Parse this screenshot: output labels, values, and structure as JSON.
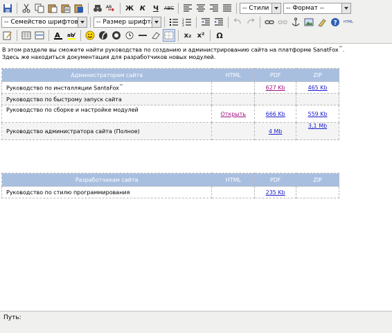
{
  "toolbar": {
    "styles_select": "-- Стили --",
    "format_select": "-- Формат --",
    "font_family_select": "-- Семейство шрифтов --",
    "font_size_select": "-- Размер шрифта --",
    "bold": "Ж",
    "italic": "К",
    "underline": "Ч",
    "strike": "ABC",
    "spell": "ABC",
    "subscript": "x₂",
    "superscript": "x²",
    "omega": "Ω",
    "html": "HTML"
  },
  "intro": {
    "line1_prefix": "В этом разделе вы сможете найти руководства по созданию и администрированию сайта на платформе SanatFox",
    "line1_tm": "™",
    "line1_suffix": ".",
    "line2": "Здесь же находиться документация для разработчиков новых модулей."
  },
  "admin_table": {
    "headers": [
      "Администраторам сайта",
      "HTML",
      "PDF",
      "ZIP"
    ],
    "rows": [
      {
        "title": "Руководство по инсталляции SantaFox",
        "tm": "™",
        "html": "",
        "pdf": "627 Kb",
        "zip": "465 Kb"
      },
      {
        "title": "Руководство по быстрому запуск сайта",
        "tm": "",
        "html": "",
        "pdf": "",
        "zip": ""
      },
      {
        "title": "Руководство по сборке и настройке модулей",
        "tm": "",
        "html": "Открыть",
        "pdf": "666 Kb",
        "zip": "559 Kb"
      },
      {
        "title": "Руководство администратора сайта (Полное)",
        "tm": "",
        "html": "",
        "pdf": "4 Mb",
        "zip": "3,1 Mb"
      }
    ]
  },
  "dev_table": {
    "headers": [
      "Разработчикам сайта",
      "HTML",
      "PDF",
      "ZIP"
    ],
    "rows": [
      {
        "title": "Руководство по стилю программирования",
        "html": "",
        "pdf": "235 Kb",
        "zip": ""
      }
    ]
  },
  "statusbar": {
    "path_label": "Путь:"
  }
}
